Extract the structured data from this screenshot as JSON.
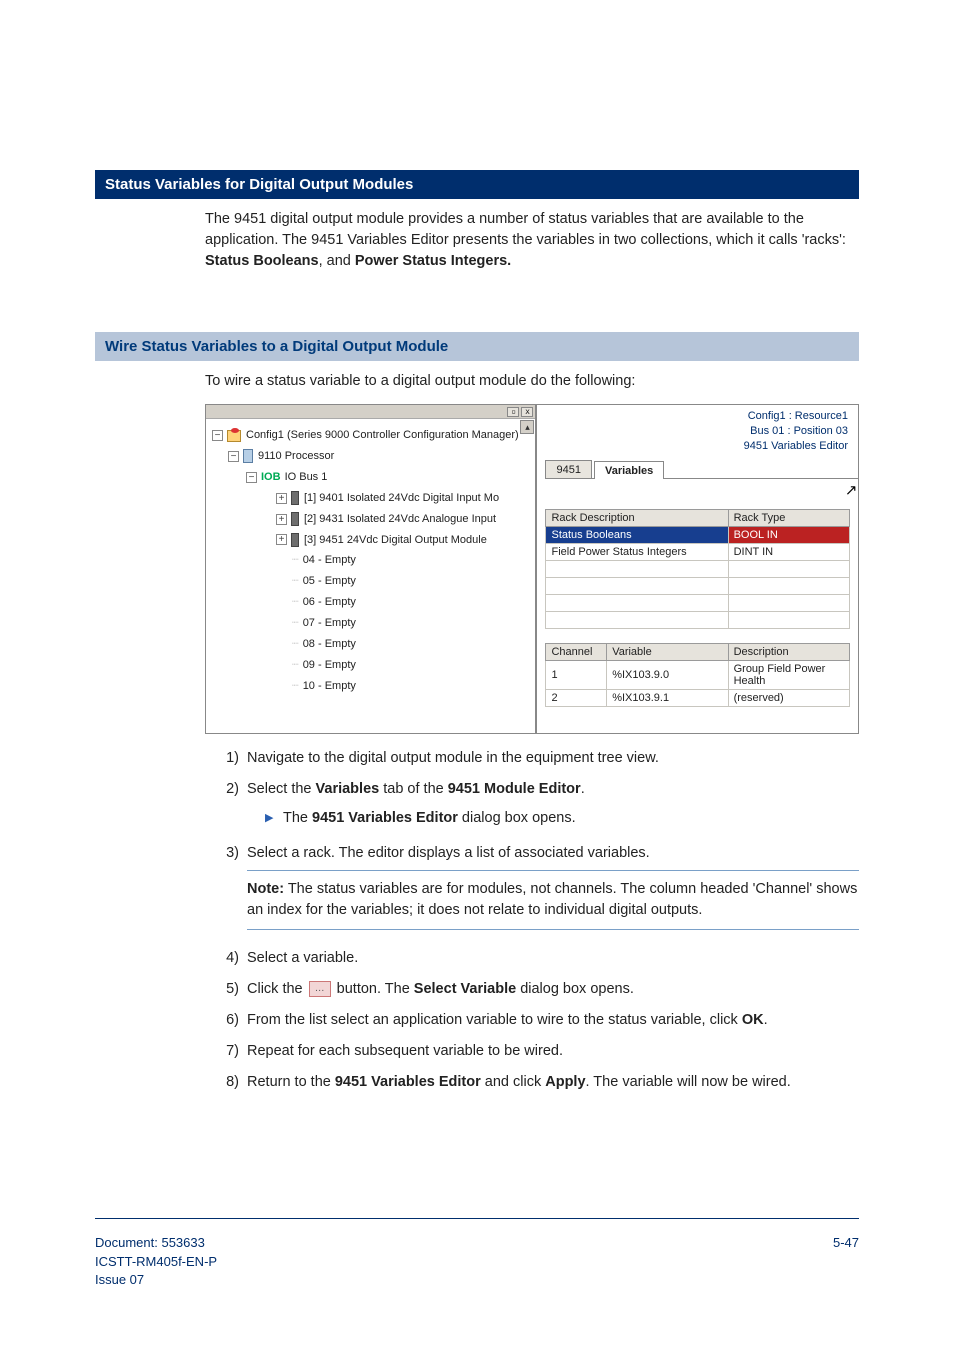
{
  "headings": {
    "h1": "Status Variables for Digital Output Modules",
    "h2": "Wire Status Variables to a Digital Output Module"
  },
  "intro": {
    "p1a": "The 9451 digital output module provides a number of status variables that are available to the application. The 9451 Variables Editor presents the variables in two collections, which it calls 'racks': ",
    "p1b": "Status Booleans",
    "p1c": ", and ",
    "p1d": "Power Status Integers."
  },
  "lead2": "To wire a status variable to a digital output module do the following:",
  "tree": {
    "root": "Config1 (Series 9000 Controller Configuration Manager)",
    "proc": "9110 Processor",
    "iob_prefix": "IOB",
    "iob_label": "IO Bus 1",
    "slots": [
      "[1] 9401 Isolated 24Vdc Digital Input Mo",
      "[2] 9431 Isolated 24Vdc Analogue Input",
      "[3] 9451 24Vdc Digital Output Module",
      "04 - Empty",
      "05 - Empty",
      "06 - Empty",
      "07 - Empty",
      "08 - Empty",
      "09 - Empty",
      "10 - Empty"
    ]
  },
  "editor": {
    "meta": [
      "Config1 : Resource1",
      "Bus 01 : Position 03",
      "9451 Variables Editor"
    ],
    "tabs": {
      "t1": "9451",
      "t2": "Variables"
    },
    "rack_headers": [
      "Rack Description",
      "Rack Type"
    ],
    "racks": [
      {
        "desc": "Status Booleans",
        "type": "BOOL IN",
        "selected": true
      },
      {
        "desc": "Field Power Status Integers",
        "type": "DINT IN",
        "selected": false
      }
    ],
    "var_headers": [
      "Channel",
      "Variable",
      "Description"
    ],
    "vars": [
      {
        "channel": "1",
        "variable": "%IX103.9.0",
        "desc": "Group Field Power Health"
      },
      {
        "channel": "2",
        "variable": "%IX103.9.1",
        "desc": "(reserved)"
      }
    ]
  },
  "steps": {
    "s1": "Navigate to the digital output module in the equipment tree view.",
    "s2a": "Select the ",
    "s2b": "Variables",
    "s2c": " tab of the ",
    "s2d": "9451 Module Editor",
    "s2e": ".",
    "s2sub_a": "The ",
    "s2sub_b": "9451 Variables Editor",
    "s2sub_c": " dialog box opens.",
    "s3": "Select a rack. The editor displays a list of associated variables.",
    "note_label": "Note:",
    "note_body": " The status variables are for modules, not channels. The column headed 'Channel' shows an index for the variables; it does not relate to individual digital outputs.",
    "s4": "Select a variable.",
    "s5a": "Click the ",
    "s5b": " button. The ",
    "s5c": "Select Variable",
    "s5d": " dialog box opens.",
    "s6a": "From the list select an application variable to wire to the status variable, click ",
    "s6b": "OK",
    "s6c": ".",
    "s7": "Repeat for each subsequent variable to be wired.",
    "s8a": "Return to the ",
    "s8b": "9451 Variables Editor",
    "s8c": " and click ",
    "s8d": "Apply",
    "s8e": ". The variable will now be wired."
  },
  "footer": {
    "doc": "Document: 553633",
    "code": "ICSTT-RM405f-EN-P",
    "issue": "Issue 07",
    "page": "5-47"
  },
  "icons": {
    "tin": "▫",
    "close": "x",
    "up": "▴",
    "cursor": "↖",
    "ellipsis": "…",
    "subarrow": "▶"
  }
}
